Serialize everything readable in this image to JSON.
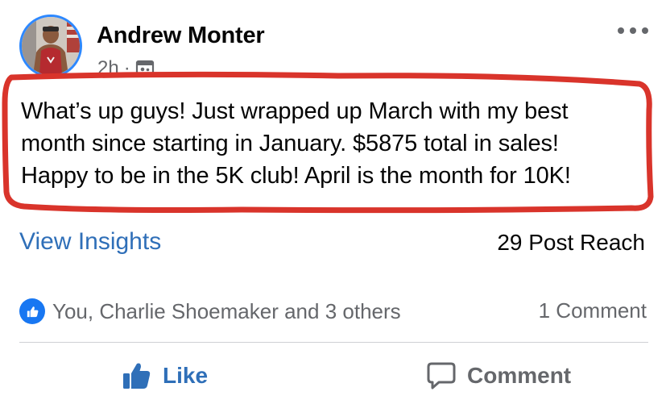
{
  "post": {
    "author": "Andrew Monter",
    "time": "2h",
    "separator": "·",
    "audience_icon": "group-audience-icon",
    "more_icon": "more-options-icon",
    "text": "What’s up guys! Just wrapped up March with my best\nmonth since starting in January. $5875 total in sales!\nHappy to be in the 5K club! April is the month for 10K!"
  },
  "insights": {
    "view_label": "View Insights",
    "reach_label": "29 Post Reach"
  },
  "reactions": {
    "icon": "like-reaction-icon",
    "summary": "You, Charlie Shoemaker and 3 others",
    "comments": "1 Comment"
  },
  "actions": {
    "like_label": "Like",
    "comment_label": "Comment"
  },
  "colors": {
    "link_blue": "#2f6fb8",
    "like_badge": "#1877f2",
    "highlight_red": "#d9342b",
    "muted_text": "#65676b"
  }
}
